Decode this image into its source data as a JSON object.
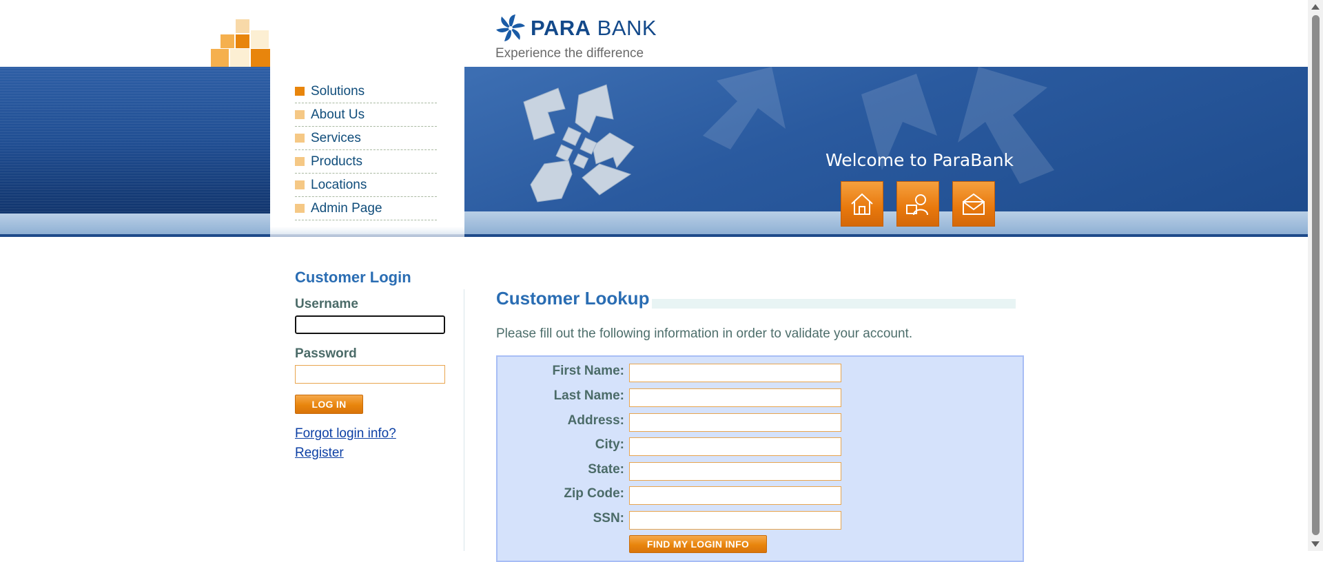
{
  "brand": {
    "logo_bold": "PARA",
    "logo_regular": "BANK",
    "tagline": "Experience the difference",
    "primary_color": "#13498a",
    "accent_color": "#e8850c"
  },
  "menu": {
    "items": [
      {
        "label": "Solutions",
        "active": true
      },
      {
        "label": "About Us"
      },
      {
        "label": "Services"
      },
      {
        "label": "Products"
      },
      {
        "label": "Locations"
      },
      {
        "label": "Admin Page"
      }
    ]
  },
  "hero": {
    "welcome": "Welcome to ParaBank",
    "buttons": [
      "home-icon",
      "contact-icon",
      "mail-icon"
    ]
  },
  "login": {
    "title": "Customer Login",
    "username_label": "Username",
    "username_value": "",
    "password_label": "Password",
    "password_value": "",
    "login_button": "LOG IN",
    "forgot_link": "Forgot login info?",
    "register_link": "Register"
  },
  "lookup": {
    "title": "Customer Lookup",
    "description": "Please fill out the following information in order to validate your account.",
    "fields": [
      {
        "label": "First Name:",
        "value": ""
      },
      {
        "label": "Last Name:",
        "value": ""
      },
      {
        "label": "Address:",
        "value": ""
      },
      {
        "label": "City:",
        "value": ""
      },
      {
        "label": "State:",
        "value": ""
      },
      {
        "label": "Zip Code:",
        "value": ""
      },
      {
        "label": "SSN:",
        "value": ""
      }
    ],
    "submit_button": "FIND MY LOGIN INFO"
  }
}
